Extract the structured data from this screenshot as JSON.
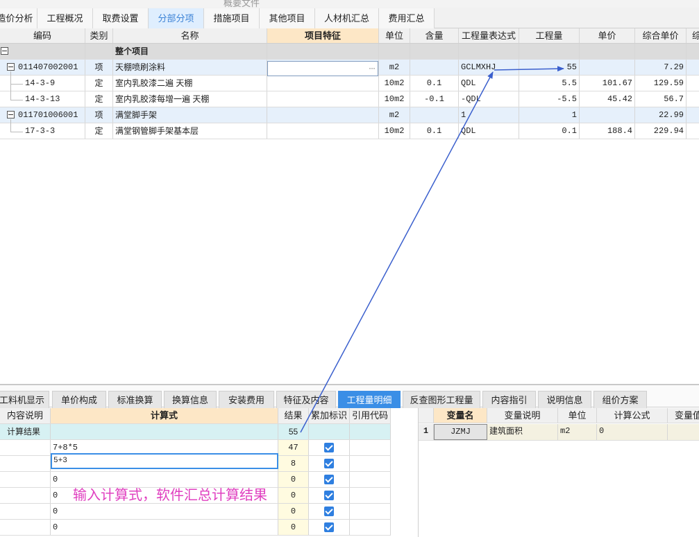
{
  "window_title": "概要文件",
  "top_tabs": [
    "造价分析",
    "工程概况",
    "取费设置",
    "分部分项",
    "措施项目",
    "其他项目",
    "人材机汇总",
    "费用汇总"
  ],
  "active_top_tab": "分部分项",
  "upper_table": {
    "headers": [
      "编码",
      "类别",
      "名称",
      "项目特征",
      "单位",
      "含量",
      "工程量表达式",
      "工程量",
      "单价",
      "综合单价",
      "综"
    ],
    "whole_label": "整个项目",
    "rows": [
      {
        "code": "011407002001",
        "type": "项",
        "name": "天棚喷刷涂料",
        "unit": "m2",
        "content": "",
        "expr": "GCLMXHJ",
        "qty": "55",
        "price": "",
        "total": "7.29"
      },
      {
        "code": "14-3-9",
        "type": "定",
        "name": "室内乳胶漆二遍 天棚",
        "unit": "10m2",
        "content": "0.1",
        "expr": "QDL",
        "qty": "5.5",
        "price": "101.67",
        "total": "129.59"
      },
      {
        "code": "14-3-13",
        "type": "定",
        "name": "室内乳胶漆每增一遍 天棚",
        "unit": "10m2",
        "content": "-0.1",
        "expr": "-QDL",
        "qty": "-5.5",
        "price": "45.42",
        "total": "56.7"
      },
      {
        "code": "011701006001",
        "type": "项",
        "name": "满堂脚手架",
        "unit": "m2",
        "content": "",
        "expr": "1",
        "qty": "1",
        "price": "",
        "total": "22.99"
      },
      {
        "code": "17-3-3",
        "type": "定",
        "name": "满堂钢管脚手架基本层",
        "unit": "10m2",
        "content": "0.1",
        "expr": "QDL",
        "qty": "0.1",
        "price": "188.4",
        "total": "229.94"
      }
    ],
    "feature_edit_icon": "ellipsis-icon"
  },
  "bottom_tabs": [
    "工料机显示",
    "单价构成",
    "标准换算",
    "换算信息",
    "安装费用",
    "特征及内容",
    "工程量明细",
    "反查图形工程量",
    "内容指引",
    "说明信息",
    "组价方案"
  ],
  "active_bottom_tab": "工程量明细",
  "calc_table": {
    "headers": [
      "内容说明",
      "计算式",
      "结果",
      "累加标识",
      "引用代码"
    ],
    "result_row": {
      "desc": "计算结果",
      "formula": "",
      "result": "55"
    },
    "rows": [
      {
        "formula": "7+8*5",
        "result": "47",
        "checked": true
      },
      {
        "formula": "5+3",
        "result": "8",
        "checked": true
      },
      {
        "formula": "0",
        "result": "0",
        "checked": true
      },
      {
        "formula": "0",
        "result": "0",
        "checked": true
      },
      {
        "formula": "0",
        "result": "0",
        "checked": true
      },
      {
        "formula": "0",
        "result": "0",
        "checked": true
      }
    ]
  },
  "var_table": {
    "headers": [
      "变量名",
      "变量说明",
      "单位",
      "计算公式",
      "变量值"
    ],
    "rows": [
      {
        "idx": "1",
        "name": "JZMJ",
        "desc": "建筑面积",
        "unit": "m2",
        "formula": "0",
        "value": ""
      }
    ]
  },
  "annotation": "输入计算式，软件汇总计算结果",
  "colors": {
    "accent": "#3a8ee6",
    "annotation": "#e040c0",
    "arrow": "#3a5fcd",
    "header_highlight": "#fde7c6"
  }
}
